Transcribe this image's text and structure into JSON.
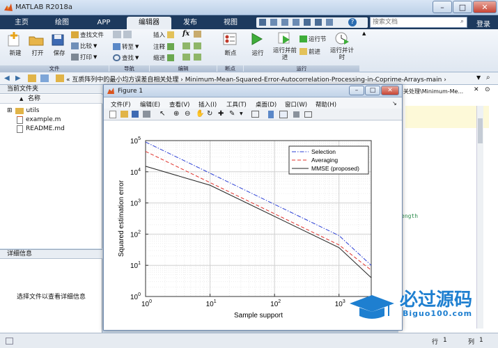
{
  "window": {
    "title": "MATLAB R2018a"
  },
  "tabs": [
    {
      "label": "主页",
      "active": false
    },
    {
      "label": "绘图",
      "active": false
    },
    {
      "label": "APP",
      "active": false
    },
    {
      "label": "编辑器",
      "active": true
    },
    {
      "label": "发布",
      "active": false
    },
    {
      "label": "视图",
      "active": false
    }
  ],
  "search": {
    "placeholder": "搜索文档",
    "login_label": "登录"
  },
  "ribbon": {
    "file_group": {
      "new": "新建",
      "open": "打开",
      "save": "保存",
      "find_files": "查找文件",
      "compare": "比较",
      "print": "打印",
      "label": "文件"
    },
    "nav_group": {
      "goto": "转至",
      "find": "查找",
      "label": "导航"
    },
    "edit_group": {
      "insert": "插入",
      "comment": "注释",
      "indent": "缩进",
      "fx": "fx",
      "label": "编辑"
    },
    "breakpoint_group": {
      "breakpoints": "断点",
      "label": "断点"
    },
    "run_group": {
      "run": "运行",
      "run_advance": "运行并前进",
      "run_section": "运行节",
      "advance": "前进",
      "run_time": "运行并计时",
      "label": "运行"
    }
  },
  "address": {
    "path": "« 互质阵列中的最小均方误差自相关处理 › Minimum-Mean-Squared-Error-Autocorrelation-Processing-in-Coprime-Arrays-main ›"
  },
  "current_folder": {
    "header": "当前文件夹",
    "col_name": "名称",
    "items": [
      {
        "name": "utils",
        "type": "folder"
      },
      {
        "name": "example.m",
        "type": "script"
      },
      {
        "name": "README.md",
        "type": "text"
      }
    ]
  },
  "details": {
    "header": "详细信息",
    "empty_text": "选择文件以查看详细信息"
  },
  "editor": {
    "snippet": "ength"
  },
  "status": {
    "row_label": "行",
    "row_value": "1",
    "col_label": "列",
    "col_value": "1"
  },
  "figure": {
    "title": "Figure 1",
    "path_fragment": "关处理\\Minimum-Me...",
    "menu": [
      "文件(F)",
      "编辑(E)",
      "查看(V)",
      "插入(I)",
      "工具(T)",
      "桌面(D)",
      "窗口(W)",
      "帮助(H)"
    ]
  },
  "watermark": {
    "text": "必过源码",
    "url": "Biguo100.com"
  },
  "colors": {
    "selection": "#2b3fd6",
    "averaging": "#e0302a",
    "mmse": "#222222",
    "tabbar": "#1d3a5e"
  },
  "chart_data": {
    "type": "line",
    "xlabel": "Sample support",
    "ylabel": "Squared estimation error",
    "xscale": "log",
    "yscale": "log",
    "xlim": [
      1,
      1000
    ],
    "ylim": [
      1,
      100000
    ],
    "xticks": [
      1,
      10,
      100,
      1000
    ],
    "yticks": [
      1,
      10,
      100,
      1000,
      10000,
      100000
    ],
    "xtick_labels": [
      "10^0",
      "10^1",
      "10^2",
      "10^3"
    ],
    "ytick_labels": [
      "10^0",
      "10^1",
      "10^2",
      "10^3",
      "10^4",
      "10^5"
    ],
    "grid": true,
    "legend_position": "top-right",
    "series": [
      {
        "name": "Selection",
        "style": "dashdot",
        "color": "#2b3fd6",
        "x": [
          1,
          10,
          100,
          1000,
          3160
        ],
        "y": [
          90000,
          9000,
          900,
          90,
          10
        ]
      },
      {
        "name": "Averaging",
        "style": "dashed",
        "color": "#e0302a",
        "x": [
          1,
          10,
          100,
          1000,
          3160
        ],
        "y": [
          45000,
          4500,
          450,
          45,
          7
        ]
      },
      {
        "name": "MMSE (proposed)",
        "style": "solid",
        "color": "#222222",
        "x": [
          1,
          10,
          100,
          1000,
          3160
        ],
        "y": [
          15000,
          3700,
          370,
          37,
          4
        ]
      }
    ]
  }
}
